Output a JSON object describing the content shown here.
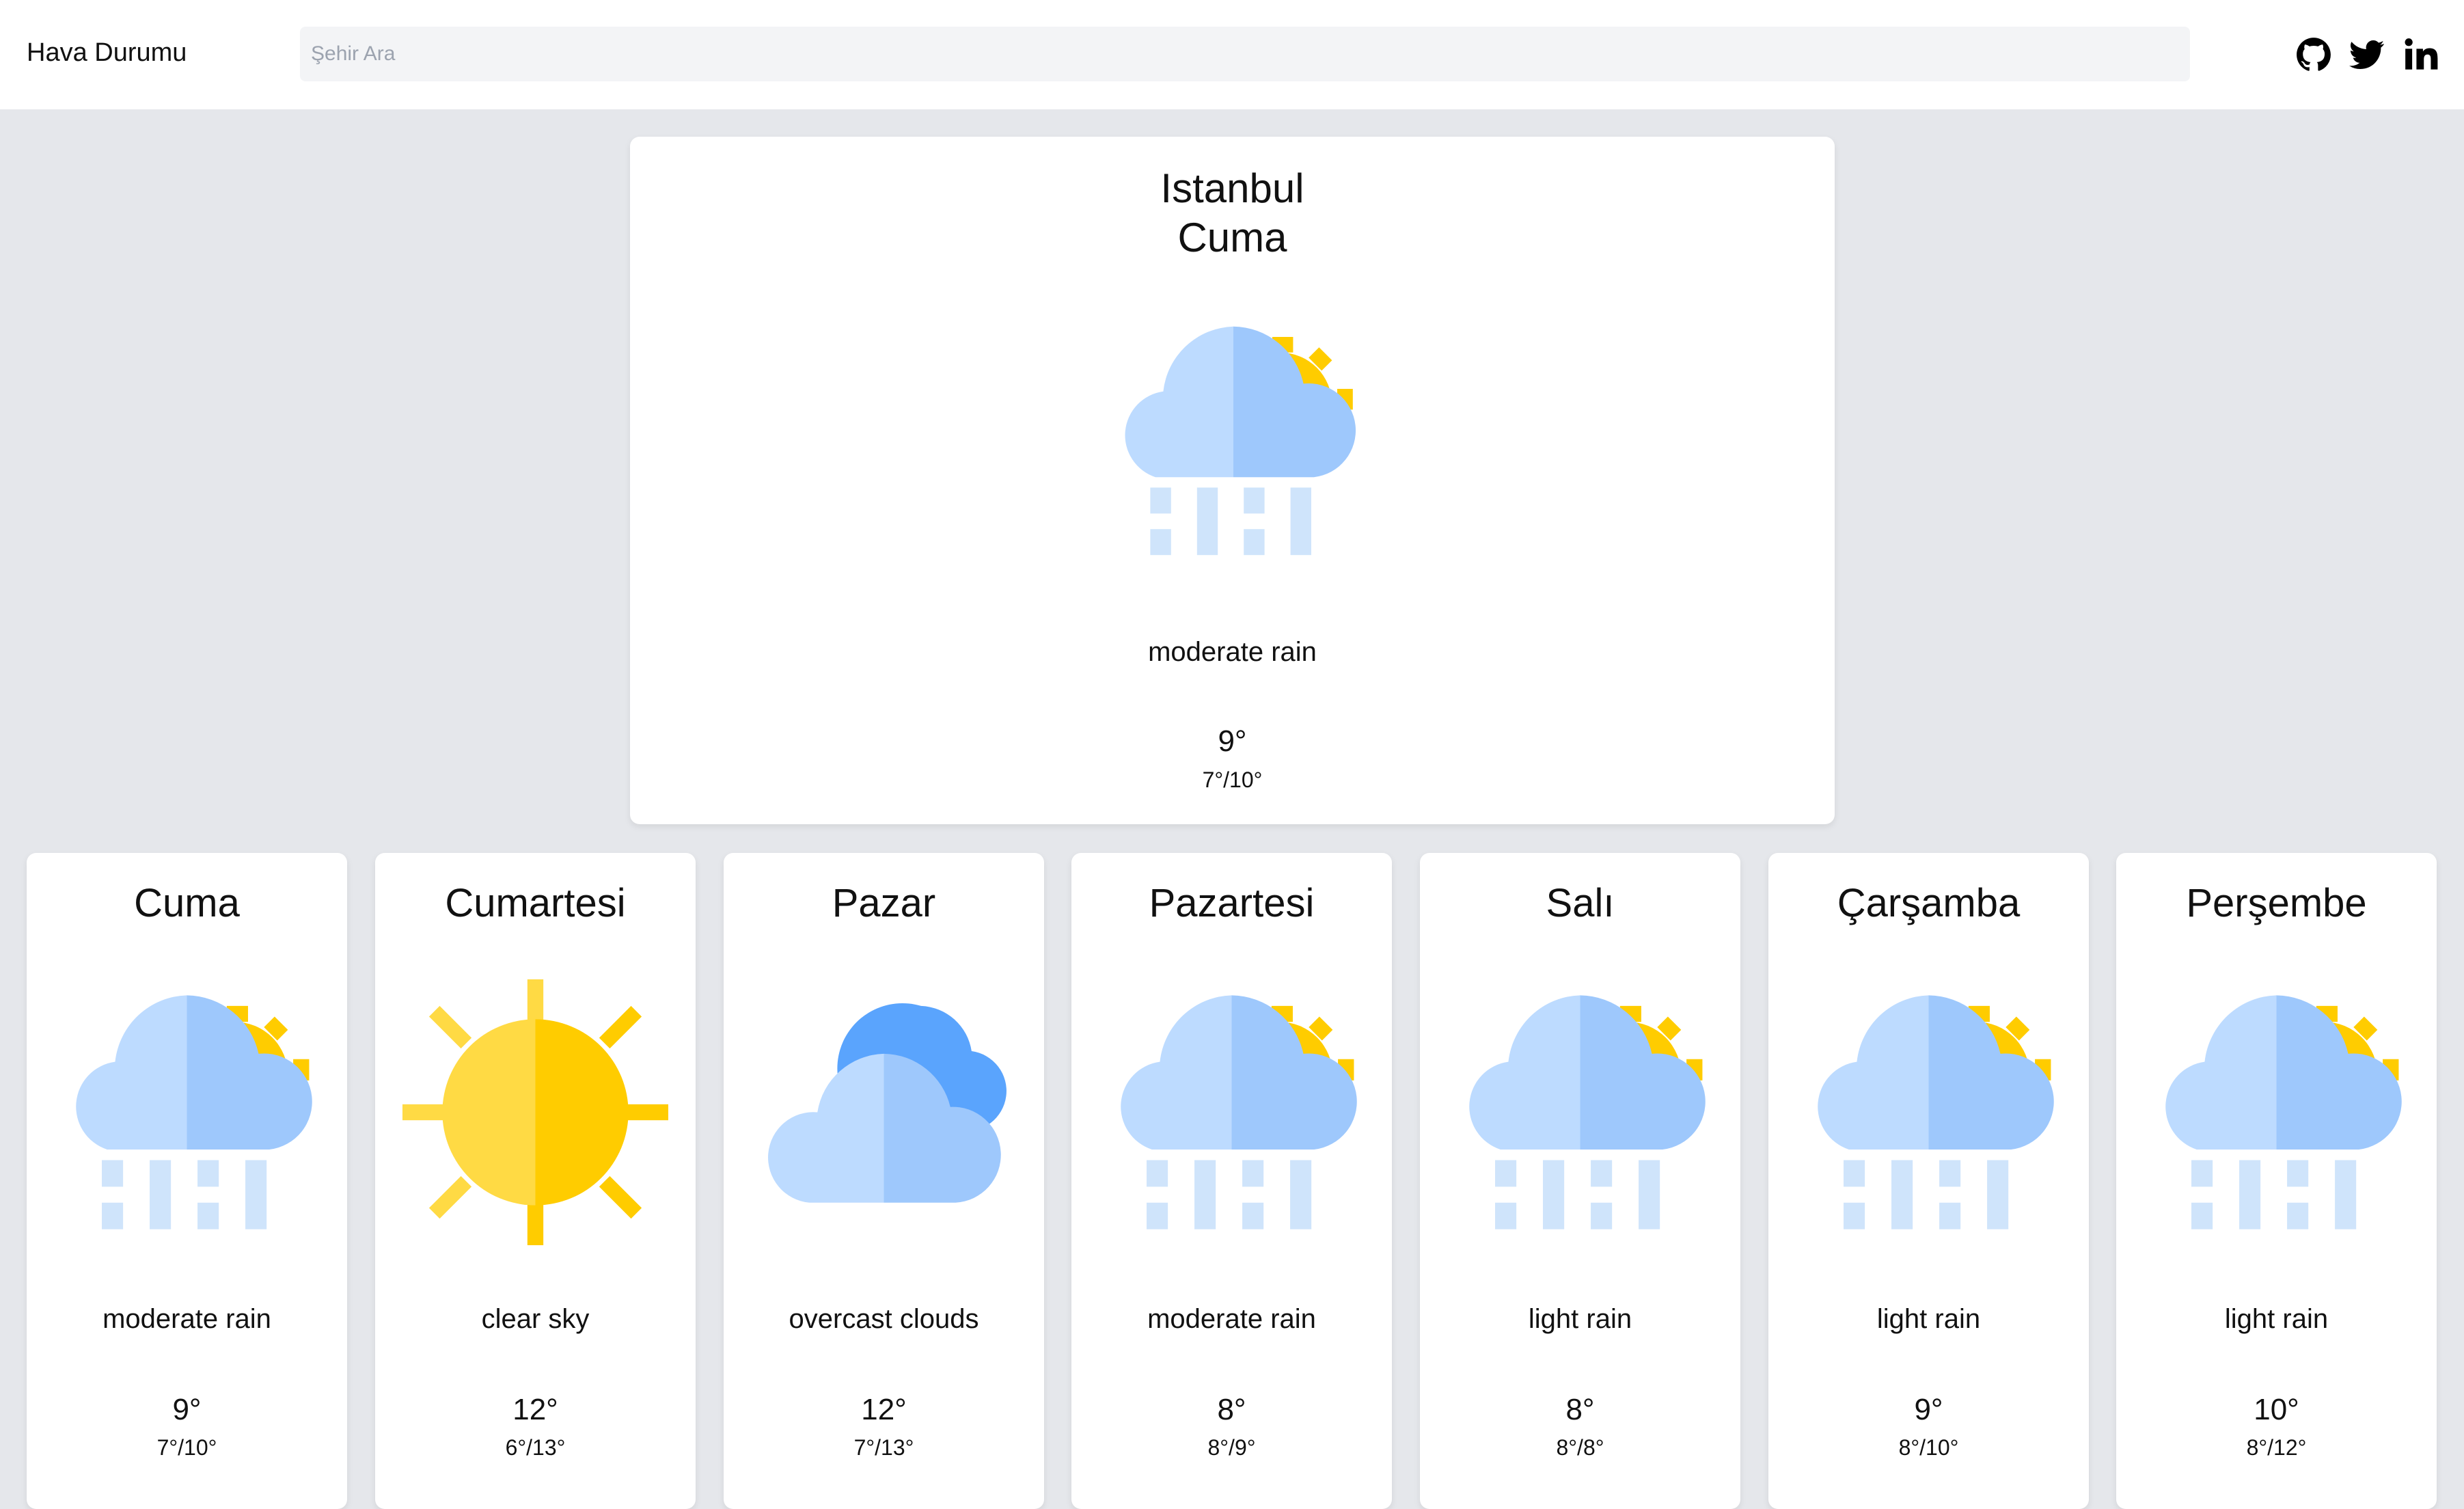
{
  "header": {
    "brand": "Hava Durumu",
    "search_placeholder": "Şehir Ara",
    "search_value": "",
    "social": [
      {
        "name": "github-icon"
      },
      {
        "name": "twitter-icon"
      },
      {
        "name": "linkedin-icon"
      }
    ]
  },
  "current": {
    "city": "Istanbul",
    "day": "Cuma",
    "icon": "rain-cloud-sun-icon",
    "description": "moderate rain",
    "temp": "9°",
    "range": "7°/10°"
  },
  "forecast": [
    {
      "day": "Cuma",
      "icon": "rain-cloud-sun-icon",
      "description": "moderate rain",
      "temp": "9°",
      "range": "7°/10°"
    },
    {
      "day": "Cumartesi",
      "icon": "sun-icon",
      "description": "clear sky",
      "temp": "12°",
      "range": "6°/13°"
    },
    {
      "day": "Pazar",
      "icon": "overcast-clouds-icon",
      "description": "overcast clouds",
      "temp": "12°",
      "range": "7°/13°"
    },
    {
      "day": "Pazartesi",
      "icon": "rain-cloud-sun-icon",
      "description": "moderate rain",
      "temp": "8°",
      "range": "8°/9°"
    },
    {
      "day": "Salı",
      "icon": "rain-cloud-sun-icon",
      "description": "light rain",
      "temp": "8°",
      "range": "8°/8°"
    },
    {
      "day": "Çarşamba",
      "icon": "rain-cloud-sun-icon",
      "description": "light rain",
      "temp": "9°",
      "range": "8°/10°"
    },
    {
      "day": "Perşembe",
      "icon": "rain-cloud-sun-icon",
      "description": "light rain",
      "temp": "10°",
      "range": "8°/12°"
    }
  ],
  "colors": {
    "page_background": "#e5e7eb",
    "card_background": "#ffffff",
    "search_background": "#f3f4f6",
    "sun_yellow": "#ffcc00",
    "sun_light": "#ffda44",
    "cloud_light": "#bddbff",
    "cloud_mid": "#9ec8fc",
    "cloud_dark": "#5aa4fd",
    "rain": "#cfe4fb"
  }
}
